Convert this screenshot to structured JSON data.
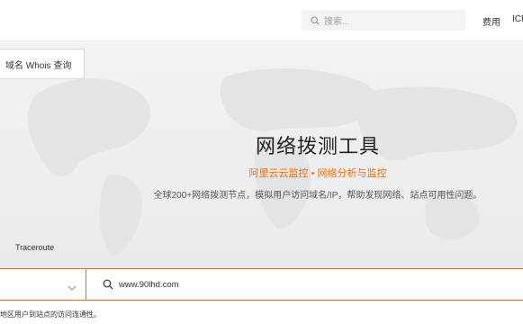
{
  "header": {
    "search_placeholder": "搜索...",
    "nav": [
      {
        "label": "费用"
      },
      {
        "label": "ICP"
      }
    ]
  },
  "hero": {
    "whois_button": "域名 Whois 查询",
    "title": "网络拨测工具",
    "subtitle": "阿里云云监控 • 网络分析与监控",
    "description": "全球200+网络拨测节点，模拟用户访问域名/IP，帮助发现网络、站点可用性问题。",
    "tab_label": "Traceroute"
  },
  "input": {
    "url_value": "www.90lhd.com"
  },
  "footer": {
    "note": "地区用户到站点的访问连通性。"
  },
  "colors": {
    "accent": "#ff6a00",
    "search_bg": "#f3f4f6"
  },
  "icons": {
    "search": "search-icon",
    "chevron": "chevron-down-icon"
  }
}
